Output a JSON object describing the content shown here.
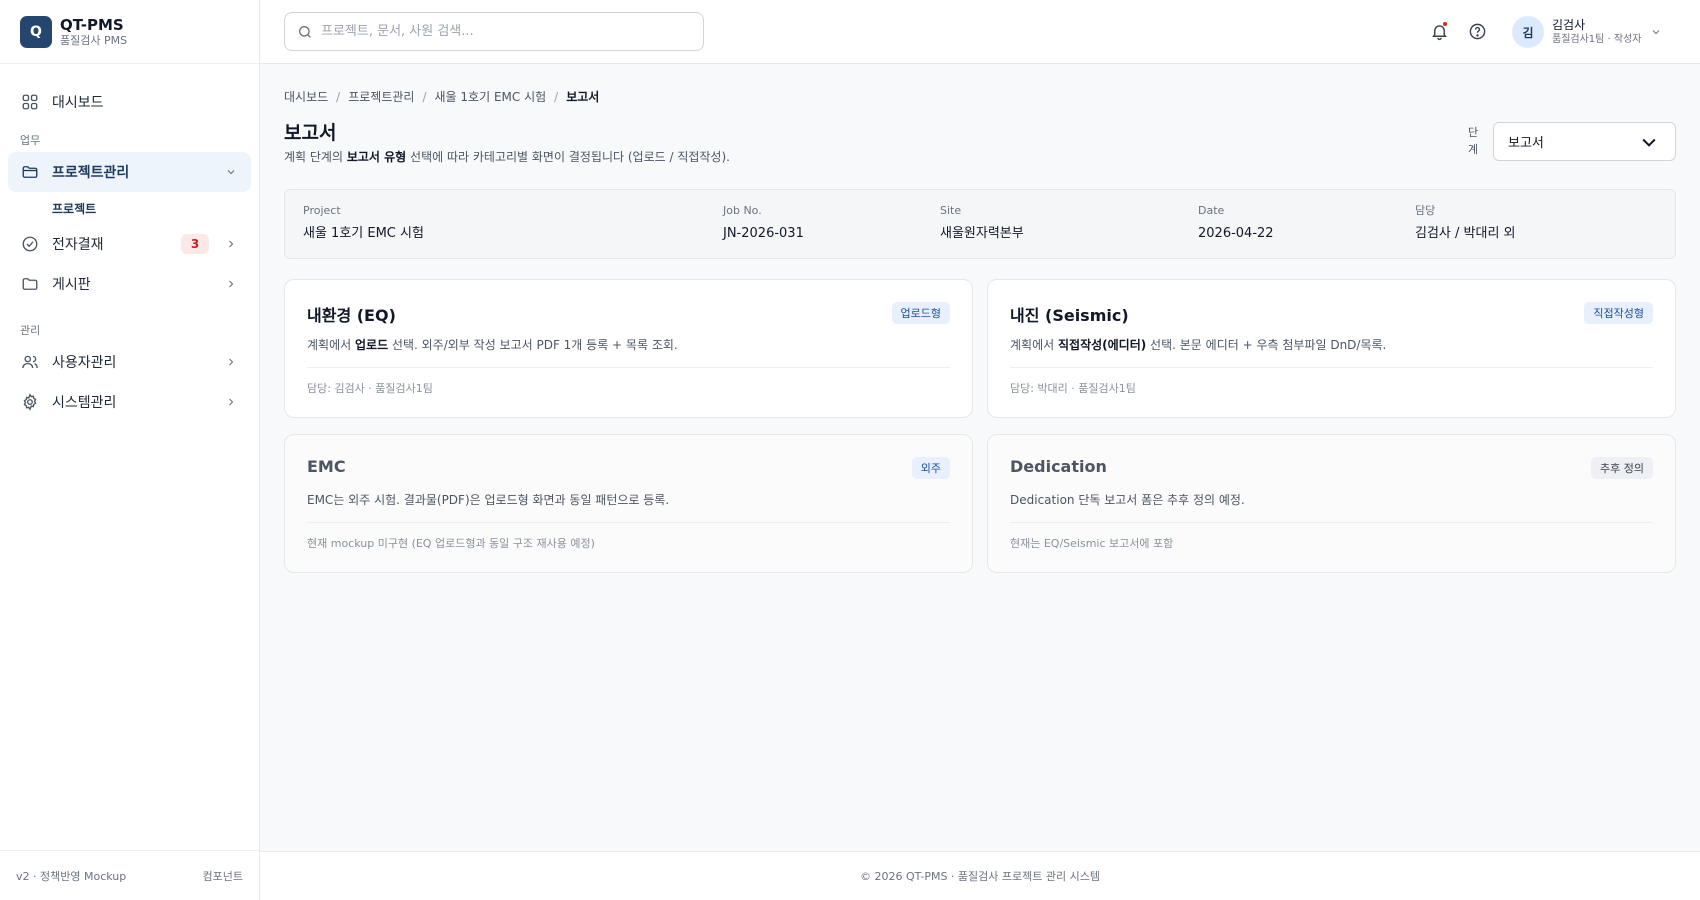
{
  "brand": {
    "logo_letter": "Q",
    "title": "QT-PMS",
    "subtitle": "품질검사 PMS"
  },
  "sidebar": {
    "dashboard": "대시보드",
    "section_work": "업무",
    "project_mgmt": "프로젝트관리",
    "project_sub": "프로젝트",
    "approval": "전자결재",
    "approval_badge": "3",
    "board": "게시판",
    "section_admin": "관리",
    "user_mgmt": "사용자관리",
    "system_mgmt": "시스템관리",
    "footer_left": "v2 · 정책반영 Mockup",
    "footer_right": "컴포넌트"
  },
  "topbar": {
    "search_placeholder": "프로젝트, 문서, 사원 검색...",
    "user_initial": "김",
    "user_name": "김검사",
    "user_role": "품질검사1팀 · 작성자"
  },
  "breadcrumb": [
    "대시보드",
    "프로젝트관리",
    "새울 1호기 EMC 시험",
    "보고서"
  ],
  "page": {
    "title": "보고서",
    "desc_1": "계획 단계의 ",
    "desc_bold": "보고서 유형",
    "desc_2": " 선택에 따라 카테고리별 화면이 결정됩니다 (업로드 / 직접작성).",
    "stage_label": "단계",
    "stage_value": "보고서"
  },
  "info": {
    "project_key": "Project",
    "project_val": "새울 1호기 EMC 시험",
    "job_key": "Job No.",
    "job_val": "JN-2026-031",
    "site_key": "Site",
    "site_val": "새울원자력본부",
    "date_key": "Date",
    "date_val": "2026-04-22",
    "owner_key": "담당",
    "owner_val": "김검사 / 박대리 외"
  },
  "cards": [
    {
      "title": "내환경 (EQ)",
      "tag": "업로드형",
      "desc_1": "계획에서 ",
      "desc_bold": "업로드",
      "desc_2": " 선택. 외주/외부 작성 보고서 PDF 1개 등록 + 목록 조회.",
      "foot": "담당: 김검사 · 품질검사1팀"
    },
    {
      "title": "내진 (Seismic)",
      "tag": "직접작성형",
      "desc_1": "계획에서 ",
      "desc_bold": "직접작성(에디터)",
      "desc_2": " 선택. 본문 에디터 + 우측 첨부파일 DnD/목록.",
      "foot": "담당: 박대리 · 품질검사1팀"
    },
    {
      "title": "EMC",
      "tag": "외주",
      "desc": "EMC는 외주 시험. 결과물(PDF)은 업로드형 화면과 동일 패턴으로 등록.",
      "foot": "현재 mockup 미구현 (EQ 업로드형과 동일 구조 재사용 예정)"
    },
    {
      "title": "Dedication",
      "tag": "추후 정의",
      "desc": "Dedication 단독 보고서 폼은 추후 정의 예정.",
      "foot": "현재는 EQ/Seismic 보고서에 포함"
    }
  ],
  "footer": "© 2026 QT-PMS · 품질검사 프로젝트 관리 시스템",
  "colors": {
    "brand": "#24466f",
    "active_nav_bg": "#eef4fb",
    "badge_red": "#c81e1e",
    "tag_blue": "#1e4fa3"
  },
  "icons": [
    "search-icon",
    "bell-icon",
    "help-icon",
    "chevron-down-icon",
    "dashboard-icon",
    "folder-icon",
    "check-circle-icon",
    "users-icon",
    "gear-icon",
    "chevron-right-icon"
  ]
}
